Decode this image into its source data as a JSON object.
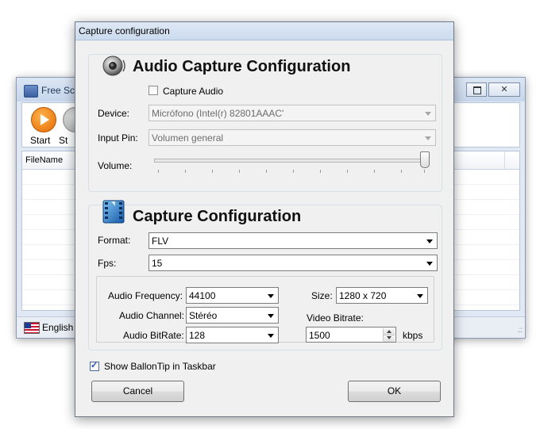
{
  "main_window": {
    "title": "Free Scr",
    "toolbar": {
      "start_label": "Start",
      "stop_label": "St"
    },
    "grid": {
      "column_filename": "FileName"
    },
    "status": {
      "language": "English"
    }
  },
  "dialog": {
    "title": "Capture configuration",
    "audio": {
      "heading": "Audio Capture Configuration",
      "capture_audio_label": "Capture Audio",
      "capture_audio_checked": false,
      "device_label": "Device:",
      "device_value": "Micrófono (Intel(r) 82801AAAC'",
      "input_pin_label": "Input Pin:",
      "input_pin_value": "Volumen general",
      "volume_label": "Volume:",
      "volume_level": 1.0
    },
    "capture": {
      "heading": "Capture Configuration",
      "format_label": "Format:",
      "format_value": "FLV",
      "fps_label": "Fps:",
      "fps_value": "15",
      "audio_frequency_label": "Audio Frequency:",
      "audio_frequency_value": "44100",
      "audio_channel_label": "Audio Channel:",
      "audio_channel_value": "Stéréo",
      "audio_bitrate_label": "Audio BitRate:",
      "audio_bitrate_value": "128",
      "size_label": "Size:",
      "size_value": "1280 x 720",
      "video_bitrate_label": "Video Bitrate:",
      "video_bitrate_value": "1500",
      "video_bitrate_unit": "kbps"
    },
    "show_balloontip_label": "Show BallonTip in Taskbar",
    "show_balloontip_checked": true,
    "cancel_label": "Cancel",
    "ok_label": "OK"
  }
}
